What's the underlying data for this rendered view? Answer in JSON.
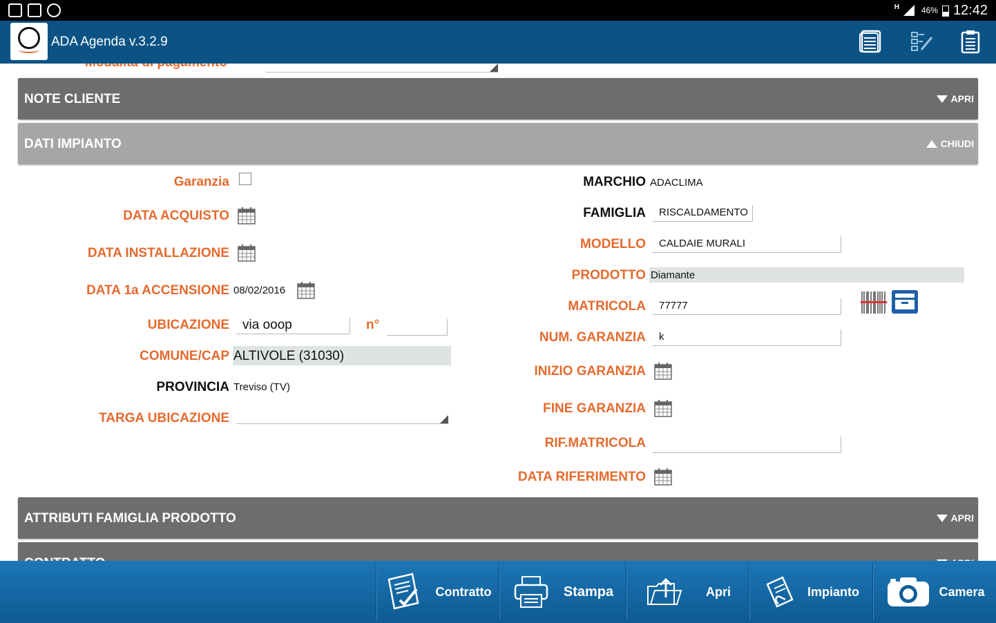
{
  "status_bar": {
    "network": "H",
    "battery": "46%",
    "time": "12:42"
  },
  "app": {
    "title": "ADA Agenda v.3.2.9"
  },
  "top_actions": [
    "document-list-icon",
    "edit-form-icon",
    "clipboard-icon"
  ],
  "cut_off": {
    "label": "Modalità di pagamento"
  },
  "sections": {
    "note_cliente": {
      "title": "NOTE CLIENTE",
      "toggle": "APRI"
    },
    "dati_impianto": {
      "title": "DATI IMPIANTO",
      "toggle": "CHIUDI"
    },
    "attributi": {
      "title": "ATTRIBUTI FAMIGLIA PRODOTTO",
      "toggle": "APRI"
    },
    "contratto": {
      "title": "CONTRATTO",
      "toggle": "APRI"
    }
  },
  "left": {
    "garanzia": {
      "label": "Garanzia",
      "checked": false
    },
    "data_acquisto": {
      "label": "DATA ACQUISTO",
      "value": ""
    },
    "data_installazione": {
      "label": "DATA INSTALLAZIONE",
      "value": ""
    },
    "data_accensione": {
      "label": "DATA 1a ACCENSIONE",
      "value": "08/02/2016"
    },
    "ubicazione": {
      "label": "UBICAZIONE",
      "value": "via ooop"
    },
    "numero": {
      "label": "n°",
      "value": ""
    },
    "comune": {
      "label": "COMUNE/CAP",
      "value": "ALTIVOLE (31030)"
    },
    "provincia": {
      "label": "PROVINCIA",
      "value": "Treviso (TV)"
    },
    "targa": {
      "label": "TARGA UBICAZIONE",
      "value": ""
    }
  },
  "right": {
    "marchio": {
      "label": "MARCHIO",
      "value": "ADACLIMA"
    },
    "famiglia": {
      "label": "FAMIGLIA",
      "value": "RISCALDAMENTO"
    },
    "modello": {
      "label": "MODELLO",
      "value": "CALDAIE MURALI"
    },
    "prodotto": {
      "label": "PRODOTTO",
      "value": "Diamante"
    },
    "matricola": {
      "label": "MATRICOLA",
      "value": "77777"
    },
    "num_garanzia": {
      "label": "NUM. GARANZIA",
      "value": "k"
    },
    "inizio_garanzia": {
      "label": "INIZIO GARANZIA",
      "value": ""
    },
    "fine_garanzia": {
      "label": "FINE GARANZIA",
      "value": ""
    },
    "rif_matricola": {
      "label": "RIF.MATRICOLA",
      "value": ""
    },
    "data_riferimento": {
      "label": "DATA RIFERIMENTO",
      "value": ""
    }
  },
  "bottom_bar": {
    "contratto": "Contratto",
    "stampa": "Stampa",
    "apri": "Apri",
    "impianto": "Impianto",
    "camera": "Camera"
  },
  "colors": {
    "accent": "#e56a2e",
    "appbar": "#0b5385",
    "section_dark": "#6b6d6e",
    "section_light": "#a6a6a6"
  }
}
